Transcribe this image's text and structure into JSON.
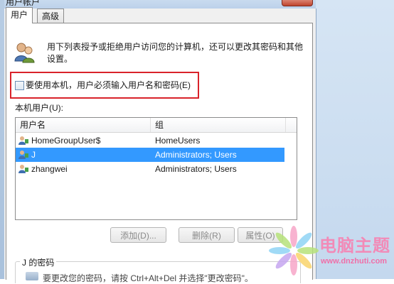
{
  "window": {
    "title": "用户帐户",
    "accent": "#3399ff",
    "highlight_color": "#d9232a"
  },
  "tabs": [
    {
      "label": "用户",
      "selected": true
    },
    {
      "label": "高级",
      "selected": false
    }
  ],
  "intro_text": "用下列表授予或拒绝用户访问您的计算机，还可以更改其密码和其他设置。",
  "require_login": {
    "label": "要使用本机，用户必须输入用户名和密码(E)",
    "checked": false
  },
  "local_users_label": "本机用户(U):",
  "table": {
    "columns": [
      "用户名",
      "组"
    ],
    "rows": [
      {
        "name": "HomeGroupUser$",
        "group": "HomeUsers",
        "selected": false
      },
      {
        "name": "J",
        "group": "Administrators; Users",
        "selected": true
      },
      {
        "name": "zhangwei",
        "group": "Administrators; Users",
        "selected": false
      }
    ]
  },
  "buttons": {
    "add": "添加(D)...",
    "remove": "删除(R)",
    "properties": "属性(O)"
  },
  "password_section": {
    "label": "J 的密码",
    "text": "要更改您的密码，请按 Ctrl+Alt+Del 并选择\"更改密码\"。"
  },
  "watermark": {
    "text": "电脑主题",
    "url": "www.dnzhuti.com"
  },
  "icons": {
    "users": "users-icon",
    "user": "user-icon",
    "password": "password-icon",
    "flower": "watermark-flower-icon"
  }
}
